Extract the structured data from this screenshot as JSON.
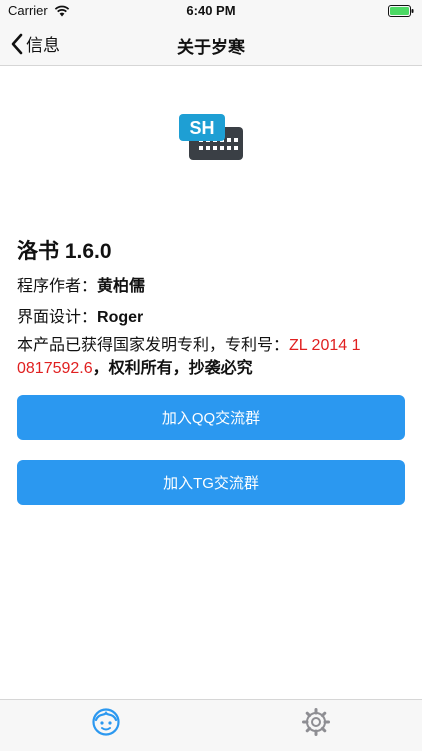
{
  "status_bar": {
    "carrier": "Carrier",
    "time": "6:40 PM",
    "wifi_icon": "wifi-icon",
    "battery_icon": "battery-icon"
  },
  "nav": {
    "back_label": "信息",
    "back_icon": "chevron-left-icon",
    "title": "关于岁寒"
  },
  "logo": {
    "text": "SH",
    "icon": "keyboard-logo-icon",
    "color_primary": "#1e9fd4",
    "color_secondary": "#3a3f45"
  },
  "app": {
    "name_version": "洛书 1.6.0"
  },
  "info": {
    "author_label": "程序作者：",
    "author_value": "黄柏儒",
    "design_label": "界面设计：",
    "design_value": "Roger"
  },
  "patent": {
    "prefix": "本产品已获得国家发明专利，专利号：",
    "number": "ZL 2014 1 0817592.6",
    "suffix": "，权利所有，抄袭必究"
  },
  "buttons": {
    "qq_group": "加入QQ交流群",
    "tg_group": "加入TG交流群"
  },
  "tabs": {
    "first_icon": "face-icon",
    "second_icon": "gear-icon",
    "active_color": "#2b98f0",
    "inactive_color": "#8e8e93"
  }
}
